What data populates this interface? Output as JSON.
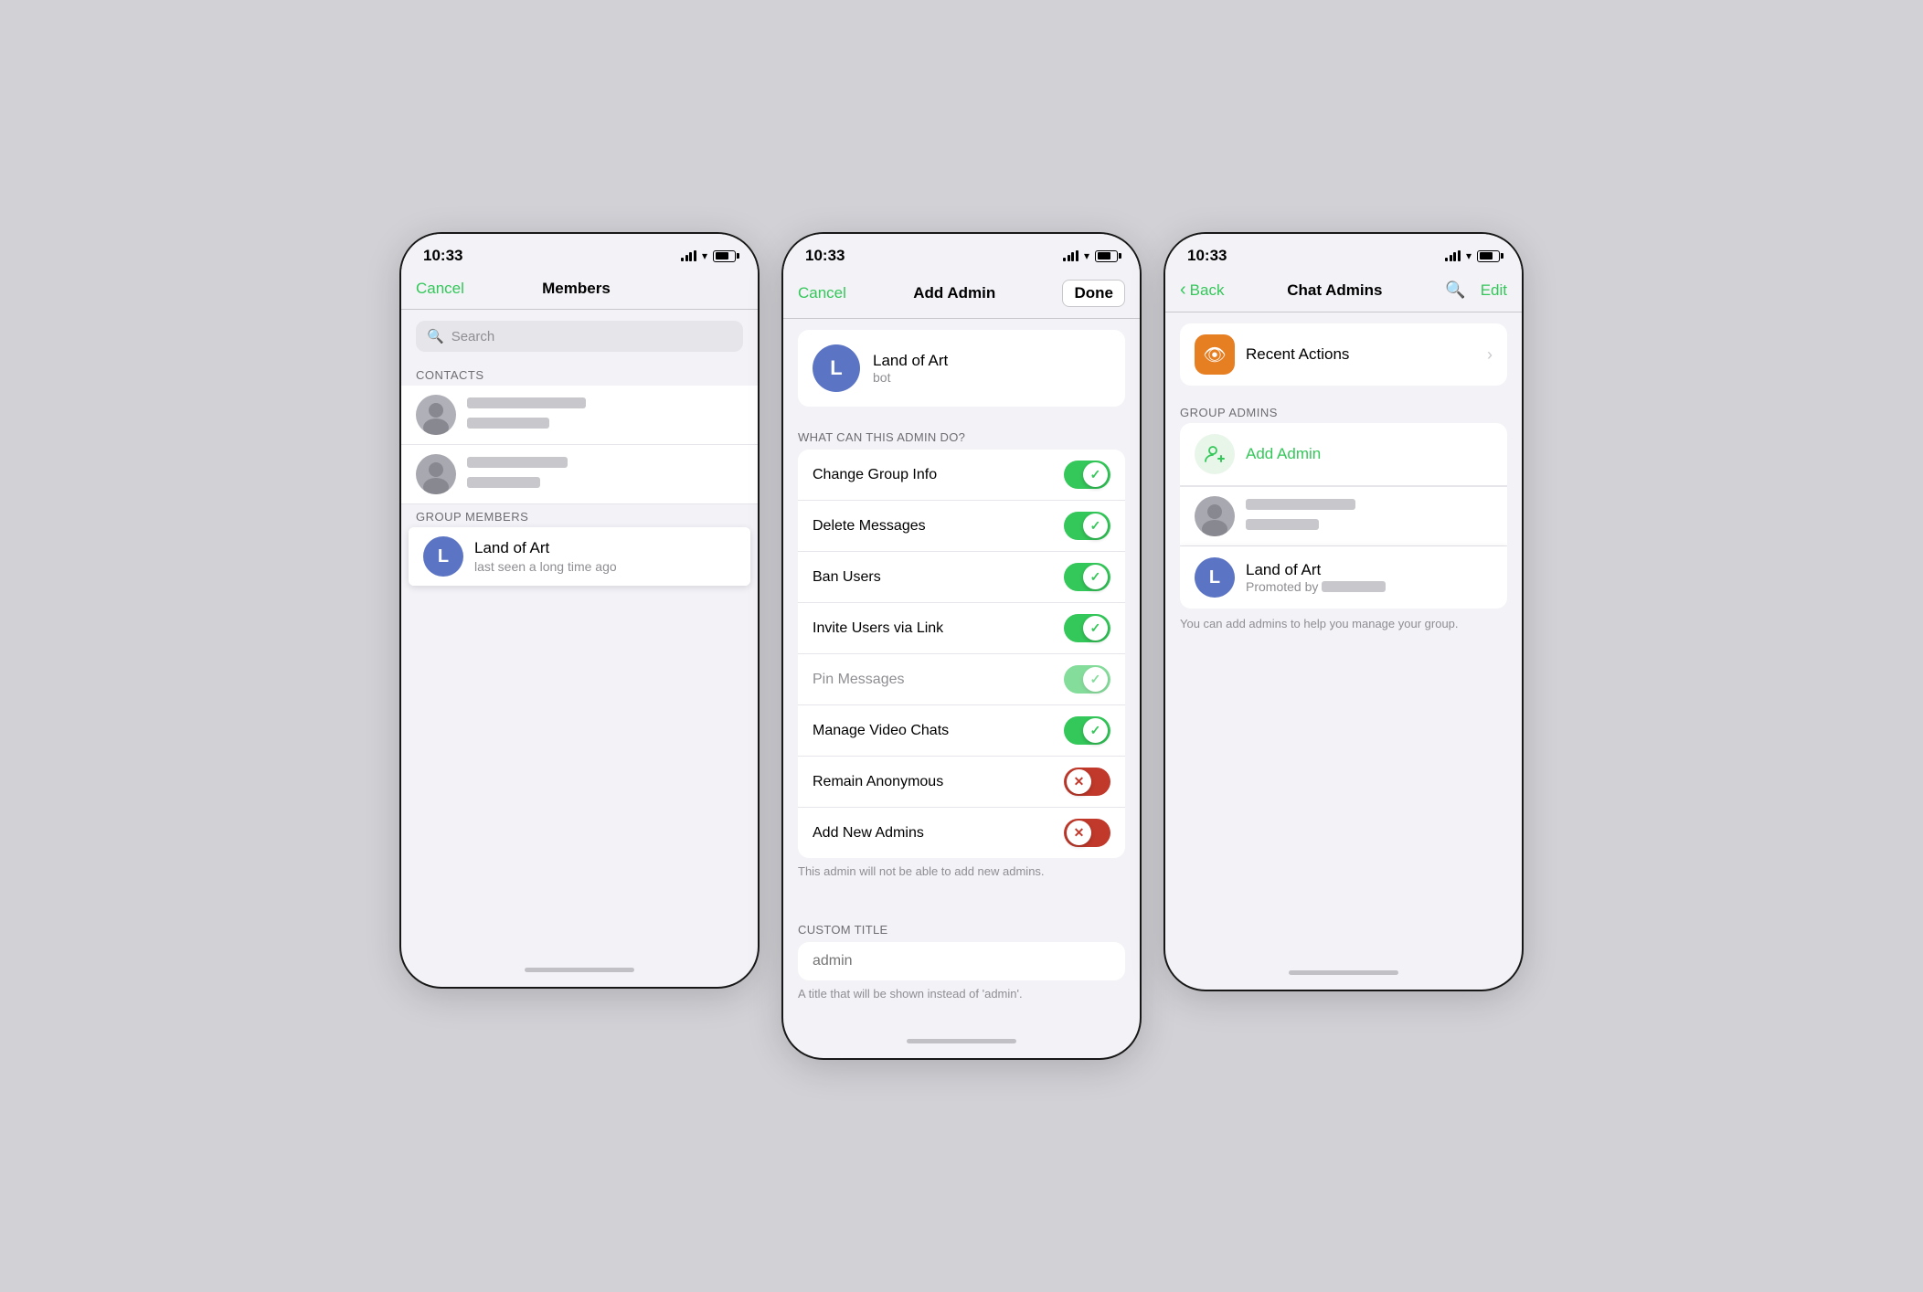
{
  "screen1": {
    "time": "10:33",
    "nav": {
      "cancel": "Cancel",
      "title": "Members",
      "done": null
    },
    "search": {
      "placeholder": "Search"
    },
    "sections": {
      "contacts": "CONTACTS",
      "group_members": "GROUP MEMBERS"
    },
    "contacts": [
      {
        "id": "c1",
        "type": "photo"
      },
      {
        "id": "c2",
        "type": "photo"
      }
    ],
    "group_members": [
      {
        "id": "land-of-art",
        "initials": "L",
        "bg_color": "#5b74c4",
        "name": "Land of Art",
        "subtitle": "last seen a long time ago",
        "highlighted": true
      }
    ]
  },
  "screen2": {
    "time": "10:33",
    "nav": {
      "cancel": "Cancel",
      "title": "Add Admin",
      "done": "Done"
    },
    "profile": {
      "initials": "L",
      "bg_color": "#5b74c4",
      "name": "Land of Art",
      "subtitle": "bot"
    },
    "section_label": "WHAT CAN THIS ADMIN DO?",
    "permissions": [
      {
        "label": "Change Group Info",
        "state": "on",
        "disabled": false
      },
      {
        "label": "Delete Messages",
        "state": "on",
        "disabled": false
      },
      {
        "label": "Ban Users",
        "state": "on",
        "disabled": false
      },
      {
        "label": "Invite Users via Link",
        "state": "on",
        "disabled": false
      },
      {
        "label": "Pin Messages",
        "state": "on-light",
        "disabled": true
      },
      {
        "label": "Manage Video Chats",
        "state": "on",
        "disabled": false
      },
      {
        "label": "Remain Anonymous",
        "state": "off-red",
        "disabled": false
      },
      {
        "label": "Add New Admins",
        "state": "off-red",
        "disabled": false
      }
    ],
    "permissions_helper": "This admin will not be able to add new admins.",
    "custom_title_label": "CUSTOM TITLE",
    "custom_title_placeholder": "admin",
    "custom_title_helper": "A title that will be shown instead of 'admin'."
  },
  "screen3": {
    "time": "10:33",
    "nav": {
      "back": "Back",
      "title": "Chat Admins",
      "search": "search",
      "edit": "Edit"
    },
    "recent_actions": {
      "label": "Recent Actions",
      "icon": "👁"
    },
    "group_admins_label": "GROUP ADMINS",
    "add_admin_label": "Add Admin",
    "admins": [
      {
        "id": "current-user",
        "type": "photo"
      },
      {
        "id": "land-of-art",
        "initials": "L",
        "bg_color": "#5b74c4",
        "name": "Land of Art",
        "subtitle": "Promoted by",
        "highlighted": true
      }
    ],
    "info_text": "You can add admins to help you manage your group."
  }
}
